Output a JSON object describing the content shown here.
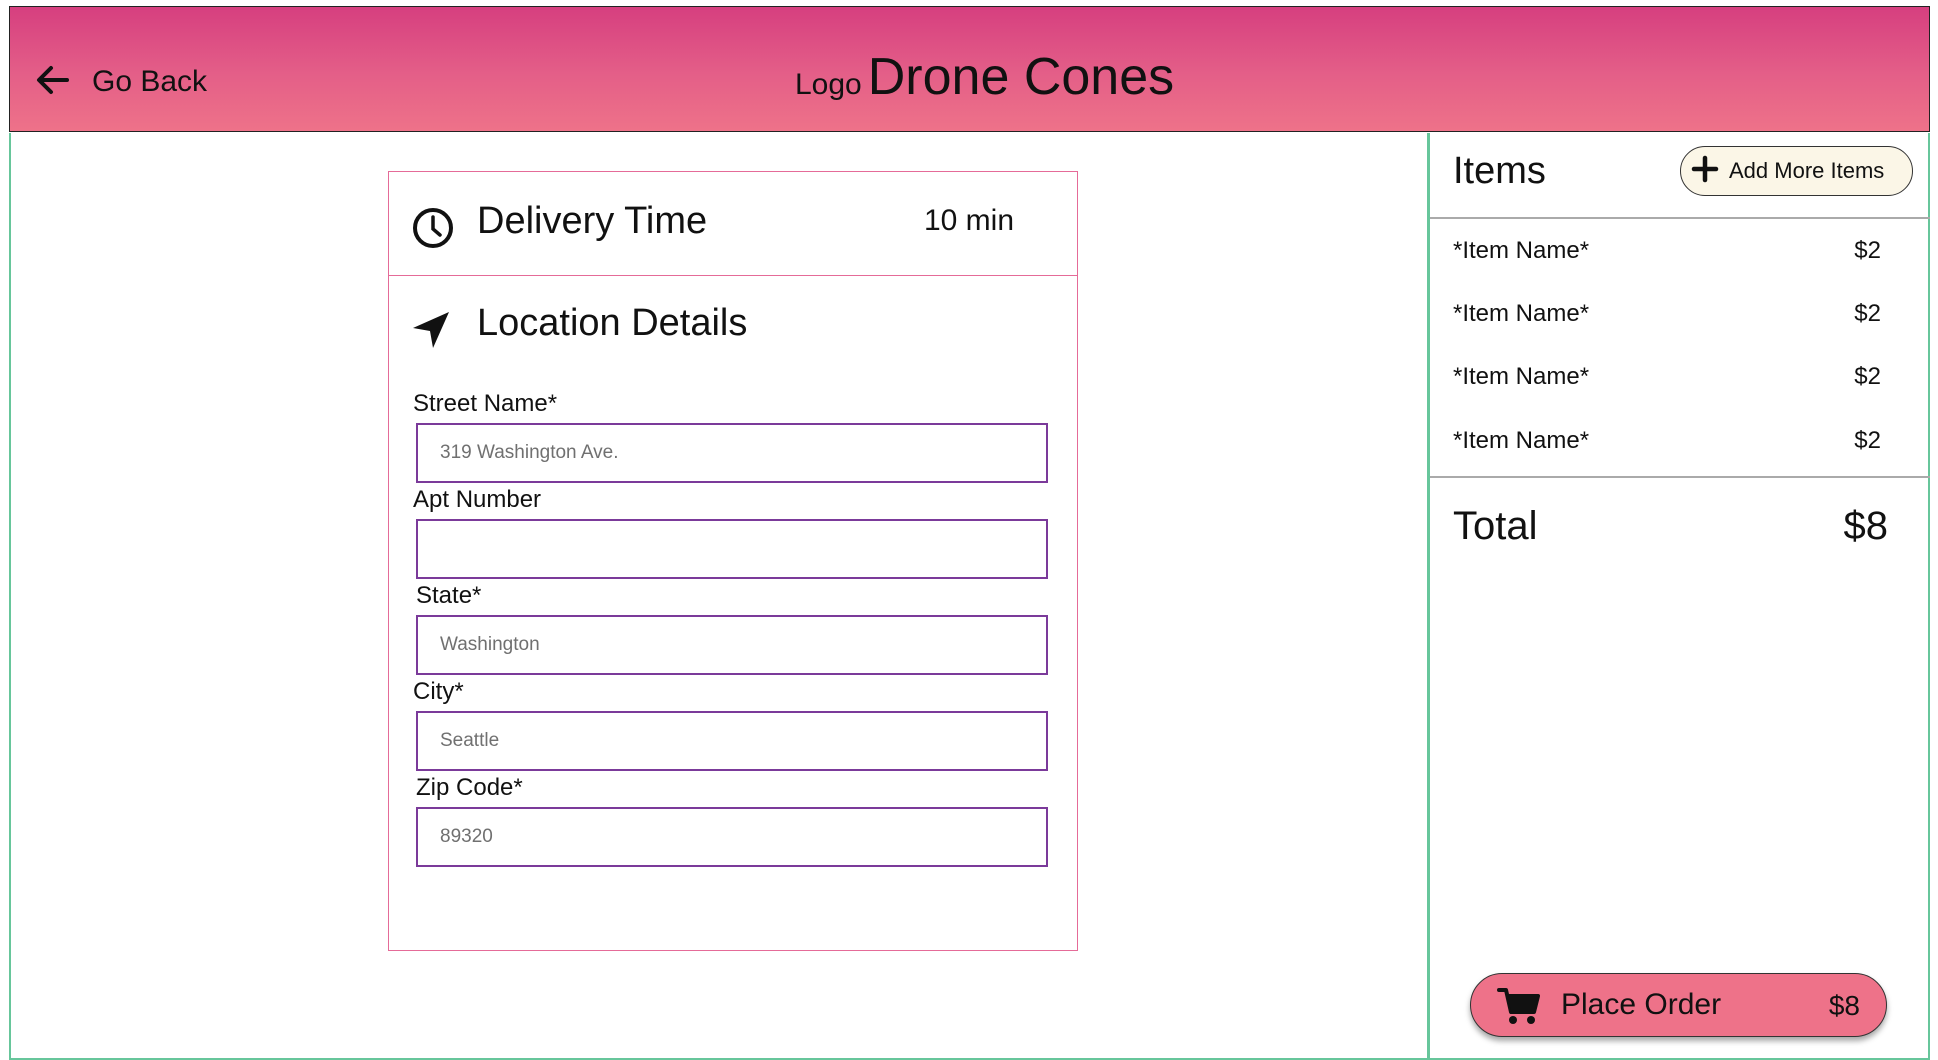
{
  "header": {
    "back_label": "Go Back",
    "logo_text": "Logo",
    "app_name": "Drone Cones"
  },
  "delivery": {
    "title": "Delivery Time",
    "value": "10 min"
  },
  "location": {
    "title": "Location Details",
    "fields": [
      {
        "label": "Street Name*",
        "placeholder": "319 Washington Ave.",
        "value": ""
      },
      {
        "label": "Apt Number",
        "placeholder": "",
        "value": ""
      },
      {
        "label": "State*",
        "placeholder": "Washington",
        "value": ""
      },
      {
        "label": "City*",
        "placeholder": "Seattle",
        "value": ""
      },
      {
        "label": "Zip Code*",
        "placeholder": "89320",
        "value": ""
      }
    ]
  },
  "cart": {
    "title": "Items",
    "add_more_label": "Add More Items",
    "items": [
      {
        "name": "*Item Name*",
        "price": "$2"
      },
      {
        "name": "*Item Name*",
        "price": "$2"
      },
      {
        "name": "*Item Name*",
        "price": "$2"
      },
      {
        "name": "*Item Name*",
        "price": "$2"
      }
    ],
    "total_label": "Total",
    "total_value": "$8"
  },
  "order_button": {
    "label": "Place Order",
    "price": "$8"
  },
  "colors": {
    "header_top": "#d63f7f",
    "header_bottom": "#ee7289",
    "frame_accent": "#67c69b",
    "card_border": "#e56b98",
    "input_border": "#7b3a9a",
    "button_bg": "#ee7289",
    "add_button_bg": "#fbf6e7"
  },
  "icons": {
    "back": "arrow-left-icon",
    "delivery": "clock-icon",
    "location": "navigation-arrow-icon",
    "add": "plus-icon",
    "order": "cart-icon"
  }
}
